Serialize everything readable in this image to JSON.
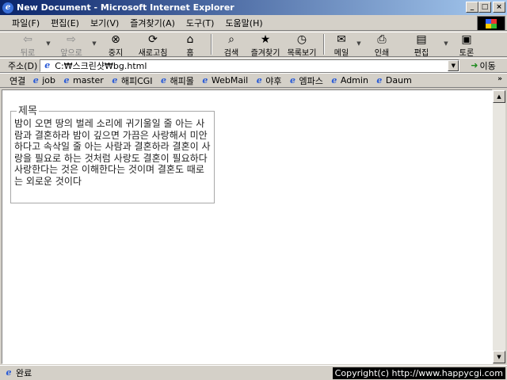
{
  "window": {
    "title": "New Document - Microsoft Internet Explorer",
    "minimize": "_",
    "maximize": "□",
    "close": "×",
    "icon": "ie-icon"
  },
  "menubar": {
    "items": [
      "파일(F)",
      "편집(E)",
      "보기(V)",
      "즐겨찾기(A)",
      "도구(T)",
      "도움말(H)"
    ]
  },
  "toolbar": {
    "back": "뒤로",
    "forward": "앞으로",
    "stop": "중지",
    "refresh": "새로고침",
    "home": "홈",
    "search": "검색",
    "favorites": "즐겨찾기",
    "history": "목록보기",
    "mail": "메일",
    "print": "인쇄",
    "edit": "편집",
    "discuss": "토론"
  },
  "address": {
    "label": "주소(D)",
    "value": "C:₩스크린샷₩bg.html",
    "go_label": "이동"
  },
  "links": {
    "label": "연결",
    "items": [
      "job",
      "master",
      "해피CGI",
      "해피몰",
      "WebMail",
      "야후",
      "엠파스",
      "Admin",
      "Daum"
    ],
    "more": "»"
  },
  "content": {
    "legend": "제목",
    "body": "밤이 오면 땅의 벌레 소리에 귀기울일 줄 아는 사람과 결혼하라 밤이 깊으면 가끔은 사랑해서 미안하다고 속삭일 줄 아는 사람과 결혼하라 결혼이 사랑을 필요로 하는 것처럼 사랑도 결혼이 필요하다 사랑한다는 것은 이해한다는 것이며 결혼도 때로는 외로운 것이다"
  },
  "status": {
    "text": "완료",
    "copyright": "Copyright(c) http://www.happycgi.com"
  }
}
